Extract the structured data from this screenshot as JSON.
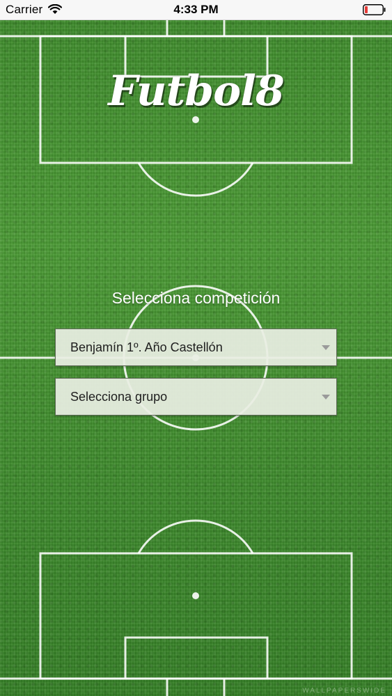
{
  "status_bar": {
    "carrier": "Carrier",
    "time": "4:33 PM",
    "icons": [
      "wifi-icon",
      "battery-icon"
    ],
    "battery_color": "#e53935"
  },
  "app": {
    "logo": "Futbol8",
    "prompt": "Selecciona competición"
  },
  "competition_select": {
    "selected_value": "Benjamín 1º. Año Castellón"
  },
  "group_select": {
    "placeholder": "Selecciona grupo"
  },
  "watermark": "WALLPAPERSWIDE",
  "colors": {
    "grass": "#3f8a2e",
    "lines": "#ffffff",
    "select_background": "#e8eee2"
  }
}
